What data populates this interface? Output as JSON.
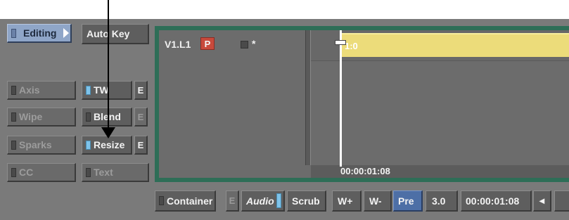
{
  "top_row": {
    "editing_label": "Editing",
    "autokey_label": "Auto Key"
  },
  "modules": [
    {
      "label": "Axis",
      "led": false
    },
    {
      "label": "Wipe",
      "led": false
    },
    {
      "label": "Sparks",
      "led": false
    },
    {
      "label": "CC",
      "led": false
    }
  ],
  "effects": [
    {
      "label": "TW",
      "led": true,
      "edit_label": "E"
    },
    {
      "label": "Blend",
      "led": false,
      "edit_label": "E"
    },
    {
      "label": "Resize",
      "led": true,
      "edit_label": "E"
    },
    {
      "label": "Text",
      "led": false
    }
  ],
  "timeline": {
    "track_label": "V1.L1",
    "priority_badge": "P",
    "star": "*",
    "clip_label": "1:0",
    "timecode": "00:00:01:08"
  },
  "toolbar": {
    "container_label": "Container",
    "e_label": "E",
    "audio_label": "Audio",
    "scrub_label": "Scrub",
    "wplus_label": "W+",
    "wminus_label": "W-",
    "pre_label": "Pre",
    "speed_value": "3.0",
    "timecode_value": "00:00:01:08",
    "step_back_symbol": "◂"
  },
  "colors": {
    "panel": "#7a7a7a",
    "button": "#5e5e5e",
    "led_on": "#7ec3ea",
    "editing_blue": "#8fa6c8",
    "timeline_border": "#2e6e57",
    "clip": "#ecdc7a",
    "priority_badge": "#c84a3c",
    "pre_active": "#4d6fa6"
  }
}
